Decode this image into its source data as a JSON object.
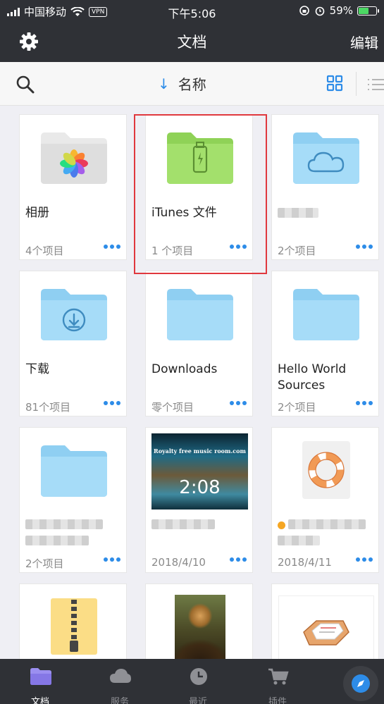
{
  "status_bar": {
    "carrier": "中国移动",
    "vpn_label": "VPN",
    "time": "下午5:06",
    "battery_percent": "59%",
    "battery_level": 0.59
  },
  "nav": {
    "title": "文档",
    "edit_label": "编辑"
  },
  "toolbar": {
    "sort_arrow": "↓",
    "sort_label": "名称"
  },
  "tiles": [
    {
      "name": "相册",
      "meta": "4个项目",
      "icon": "photos-folder-icon"
    },
    {
      "name": "iTunes 文件",
      "meta": "1 个项目",
      "icon": "usb-folder-icon"
    },
    {
      "name": "",
      "meta": "2个项目",
      "icon": "cloud-folder-icon"
    },
    {
      "name": "下载",
      "meta": "81个项目",
      "icon": "download-folder-icon"
    },
    {
      "name": "Downloads",
      "meta": "零个项目",
      "icon": "folder-icon"
    },
    {
      "name": "Hello World Sources",
      "meta": "2个项目",
      "icon": "folder-icon"
    },
    {
      "name": "",
      "meta": "2个项目",
      "icon": "folder-icon"
    },
    {
      "name": "",
      "meta": "2018/4/10",
      "icon": "video-thumbnail",
      "video_duration": "2:08",
      "video_overlay_text": "Royalty free music room.com"
    },
    {
      "name": "",
      "meta": "2018/4/11",
      "icon": "lifebuoy-icon"
    },
    {
      "name": "",
      "meta": "",
      "icon": "zip-archive-icon"
    },
    {
      "name": "",
      "meta": "",
      "icon": "mona-lisa-image"
    },
    {
      "name": "",
      "meta": "",
      "icon": "inbox-tray-icon"
    }
  ],
  "tab_bar": {
    "items": [
      {
        "label": "文档",
        "icon": "folder-icon",
        "active": true
      },
      {
        "label": "服务",
        "icon": "cloud-icon",
        "active": false
      },
      {
        "label": "最近",
        "icon": "clock-icon",
        "active": false
      },
      {
        "label": "插件",
        "icon": "cart-icon",
        "active": false
      }
    ]
  },
  "colors": {
    "bar_dark": "#2f3136",
    "accent_blue": "#2d8ce8",
    "folder_blue": "#a6dcf8",
    "folder_green": "#a3e06c",
    "highlight_red": "#e0383e"
  }
}
